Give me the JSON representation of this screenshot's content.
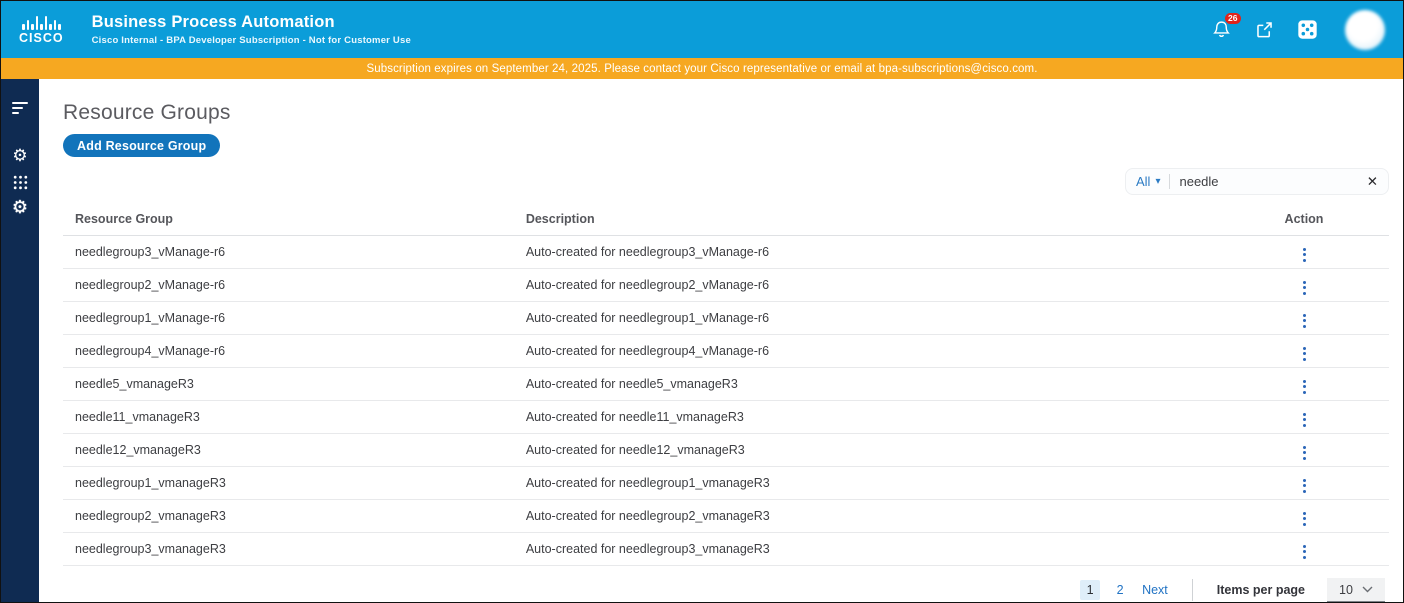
{
  "colors": {
    "header_blue": "#0B9DD9",
    "banner_orange": "#F6A821",
    "sidebar_navy": "#0F2B52",
    "button_blue": "#1274BB",
    "link_blue": "#2173C4",
    "badge_red": "#E2231A",
    "active_page_bg": "#DFEEF9"
  },
  "header": {
    "logo_text": "CISCO",
    "title": "Business Process Automation",
    "subtitle": "Cisco Internal - BPA Developer Subscription - Not for Customer Use",
    "notification_badge": "26"
  },
  "banner": {
    "text": "Subscription expires on September 24, 2025. Please contact your Cisco representative or email at bpa-subscriptions@cisco.com."
  },
  "sidebar": {
    "icons": [
      "menu",
      "gear",
      "app-grid",
      "automation-gear"
    ]
  },
  "main": {
    "page_title": "Resource Groups",
    "add_button": "Add Resource Group",
    "filter": {
      "scope": "All",
      "query": "needle"
    },
    "table": {
      "columns": [
        "Resource Group",
        "Description",
        "Action"
      ],
      "rows": [
        {
          "name": "needlegroup3_vManage-r6",
          "description": "Auto-created for needlegroup3_vManage-r6"
        },
        {
          "name": "needlegroup2_vManage-r6",
          "description": "Auto-created for needlegroup2_vManage-r6"
        },
        {
          "name": "needlegroup1_vManage-r6",
          "description": "Auto-created for needlegroup1_vManage-r6"
        },
        {
          "name": "needlegroup4_vManage-r6",
          "description": "Auto-created for needlegroup4_vManage-r6"
        },
        {
          "name": "needle5_vmanageR3",
          "description": "Auto-created for needle5_vmanageR3"
        },
        {
          "name": "needle11_vmanageR3",
          "description": "Auto-created for needle11_vmanageR3"
        },
        {
          "name": "needle12_vmanageR3",
          "description": "Auto-created for needle12_vmanageR3"
        },
        {
          "name": "needlegroup1_vmanageR3",
          "description": "Auto-created for needlegroup1_vmanageR3"
        },
        {
          "name": "needlegroup2_vmanageR3",
          "description": "Auto-created for needlegroup2_vmanageR3"
        },
        {
          "name": "needlegroup3_vmanageR3",
          "description": "Auto-created for needlegroup3_vmanageR3"
        }
      ]
    },
    "pagination": {
      "page1": "1",
      "page2": "2",
      "active_page": "1",
      "next_label": "Next",
      "items_per_page_label": "Items per page",
      "items_per_page_value": "10"
    }
  },
  "icons": {
    "close": "✕",
    "caret_down": "▾",
    "gear": "⚙",
    "select_chevron": "⌄"
  }
}
